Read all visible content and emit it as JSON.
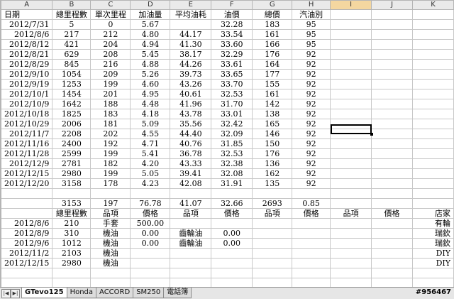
{
  "columns": [
    "A",
    "B",
    "C",
    "D",
    "E",
    "F",
    "G",
    "H",
    "I",
    "J",
    "K"
  ],
  "headers": [
    "日期",
    "總里程數",
    "單次里程",
    "加油量",
    "平均油耗",
    "油價",
    "總價",
    "汽油別"
  ],
  "rows": [
    [
      "2012/7/31",
      "5",
      "0",
      "5.67",
      "",
      "32.28",
      "183",
      "95"
    ],
    [
      "2012/8/6",
      "217",
      "212",
      "4.80",
      "44.17",
      "33.54",
      "161",
      "95"
    ],
    [
      "2012/8/12",
      "421",
      "204",
      "4.94",
      "41.30",
      "33.60",
      "166",
      "95"
    ],
    [
      "2012/8/21",
      "629",
      "208",
      "5.45",
      "38.17",
      "32.29",
      "176",
      "92"
    ],
    [
      "2012/8/29",
      "845",
      "216",
      "4.88",
      "44.26",
      "33.61",
      "164",
      "92"
    ],
    [
      "2012/9/10",
      "1054",
      "209",
      "5.26",
      "39.73",
      "33.65",
      "177",
      "92"
    ],
    [
      "2012/9/19",
      "1253",
      "199",
      "4.60",
      "43.26",
      "33.70",
      "155",
      "92"
    ],
    [
      "2012/10/1",
      "1454",
      "201",
      "4.95",
      "40.61",
      "32.53",
      "161",
      "92"
    ],
    [
      "2012/10/9",
      "1642",
      "188",
      "4.48",
      "41.96",
      "31.70",
      "142",
      "92"
    ],
    [
      "2012/10/18",
      "1825",
      "183",
      "4.18",
      "43.78",
      "33.01",
      "138",
      "92"
    ],
    [
      "2012/10/29",
      "2006",
      "181",
      "5.09",
      "35.56",
      "32.42",
      "165",
      "92"
    ],
    [
      "2012/11/7",
      "2208",
      "202",
      "4.55",
      "44.40",
      "32.09",
      "146",
      "92"
    ],
    [
      "2012/11/16",
      "2400",
      "192",
      "4.71",
      "40.76",
      "31.85",
      "150",
      "92"
    ],
    [
      "2012/11/28",
      "2599",
      "199",
      "5.41",
      "36.78",
      "32.53",
      "176",
      "92"
    ],
    [
      "2012/12/9",
      "2781",
      "182",
      "4.20",
      "43.33",
      "32.38",
      "136",
      "92"
    ],
    [
      "2012/12/15",
      "2980",
      "199",
      "5.05",
      "39.41",
      "32.08",
      "162",
      "92"
    ],
    [
      "2012/12/20",
      "3158",
      "178",
      "4.23",
      "42.08",
      "31.91",
      "135",
      "92"
    ]
  ],
  "totals": [
    "",
    "3153",
    "197",
    "76.78",
    "41.07",
    "32.66",
    "2693",
    "0.85"
  ],
  "headers2": [
    "",
    "總里程數",
    "品項",
    "價格",
    "品項",
    "價格",
    "品項",
    "價格",
    "品項",
    "價格",
    "店家"
  ],
  "rows2": [
    [
      "2012/8/6",
      "210",
      "手套",
      "500.00",
      "",
      "",
      "",
      "",
      "",
      "",
      "有輪"
    ],
    [
      "2012/8/9",
      "310",
      "機油",
      "0.00",
      "齒輪油",
      "0.00",
      "",
      "",
      "",
      "",
      "瑞欽"
    ],
    [
      "2012/9/6",
      "1012",
      "機油",
      "0.00",
      "齒輪油",
      "0.00",
      "",
      "",
      "",
      "",
      "瑞欽"
    ],
    [
      "2012/11/2",
      "2103",
      "機油",
      "",
      "",
      "",
      "",
      "",
      "",
      "",
      "DIY"
    ],
    [
      "2012/12/15",
      "2980",
      "機油",
      "",
      "",
      "",
      "",
      "",
      "",
      "",
      "DIY"
    ]
  ],
  "tabs": [
    "GTevo125",
    "Honda",
    "ACCORD",
    "SM250",
    "電話簿"
  ],
  "active_tab": "GTevo125",
  "watermark": "#956467",
  "colors": {
    "header_bg": "#eaeaea",
    "selected_header": "#f4d7a0",
    "grid": "#c8c8c8"
  }
}
